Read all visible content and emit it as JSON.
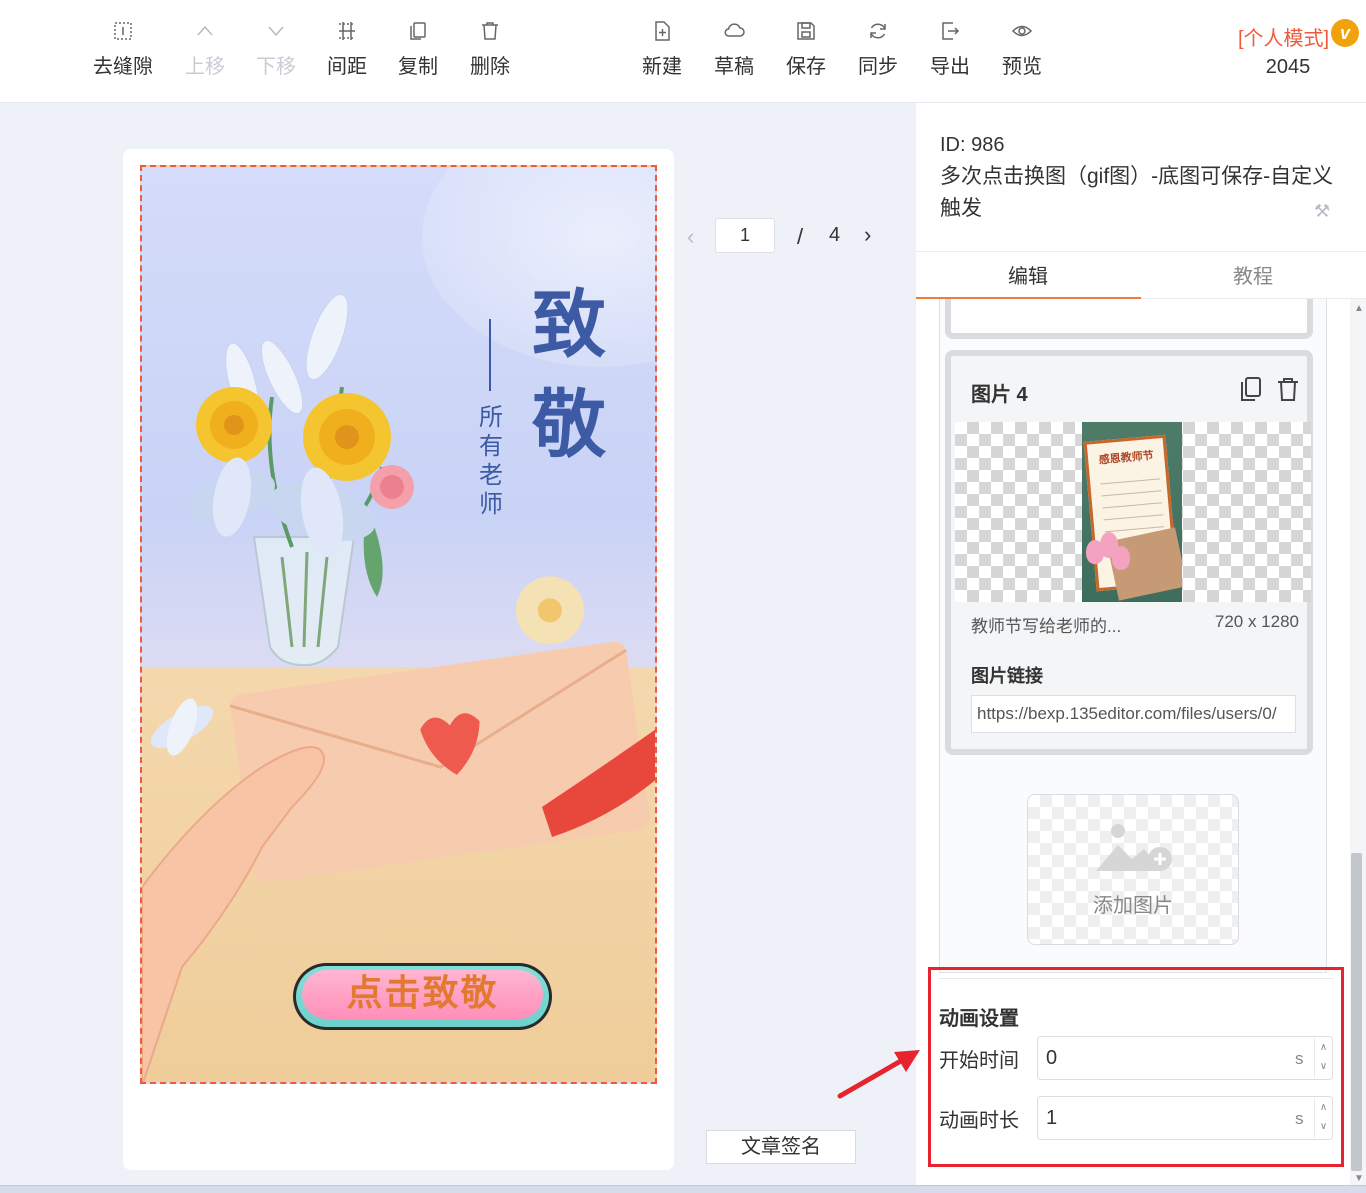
{
  "toolbar": {
    "left_buttons": [
      {
        "label": "去缝隙",
        "icon": "gap-remove-icon",
        "disabled": false
      },
      {
        "label": "上移",
        "icon": "chevron-up-icon",
        "disabled": true
      },
      {
        "label": "下移",
        "icon": "chevron-down-icon",
        "disabled": true
      },
      {
        "label": "间距",
        "icon": "spacing-icon",
        "disabled": false
      },
      {
        "label": "复制",
        "icon": "copy-icon",
        "disabled": false
      },
      {
        "label": "删除",
        "icon": "trash-icon",
        "disabled": false
      }
    ],
    "right_buttons": [
      {
        "label": "新建",
        "icon": "new-file-icon"
      },
      {
        "label": "草稿",
        "icon": "cloud-icon"
      },
      {
        "label": "保存",
        "icon": "save-icon"
      },
      {
        "label": "同步",
        "icon": "sync-icon"
      },
      {
        "label": "导出",
        "icon": "export-icon"
      },
      {
        "label": "预览",
        "icon": "eye-icon"
      }
    ],
    "mode_label": "[个人模式]",
    "vip_badge": "v",
    "count": "2045"
  },
  "canvas": {
    "title_line1": "致",
    "title_line2": "敬",
    "subtitle_vertical": "所有老师",
    "cta_label": "点击致敬"
  },
  "pager": {
    "current": "1",
    "separator": "/",
    "total": "4"
  },
  "sign_button": "文章签名",
  "panel": {
    "id_label": "ID: 986",
    "description": "多次点击换图（gif图）-底图可保存-自定义触发",
    "tabs": [
      {
        "label": "编辑",
        "active": true
      },
      {
        "label": "教程",
        "active": false
      }
    ],
    "image_card": {
      "title": "图片 4",
      "thumb_heading": "感恩教师节",
      "file_name": "教师节写给老师的...",
      "dimensions": "720 x 1280",
      "link_label": "图片链接",
      "link_value": "https://bexp.135editor.com/files/users/0/"
    },
    "add_image_label": "添加图片",
    "animation": {
      "title": "动画设置",
      "start_label": "开始时间",
      "start_value": "0",
      "duration_label": "动画时长",
      "duration_value": "1",
      "unit": "s"
    }
  },
  "colors": {
    "accent": "#f07a3c",
    "mode_red": "#f05a3c",
    "highlight_red": "#e6232f",
    "title_blue": "#3d5aa5"
  }
}
